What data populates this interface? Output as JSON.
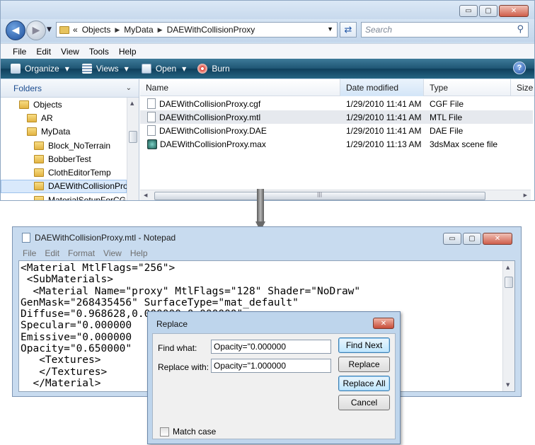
{
  "explorer": {
    "window_buttons": {
      "minimize": "▭",
      "maximize": "▢",
      "close": "✕"
    },
    "address": {
      "prefix": "«",
      "segments": [
        "Objects",
        "MyData",
        "DAEWithCollisionProxy"
      ]
    },
    "search_placeholder": "Search",
    "menu": [
      "File",
      "Edit",
      "View",
      "Tools",
      "Help"
    ],
    "toolbar": {
      "organize": "Organize",
      "views": "Views",
      "open": "Open",
      "burn": "Burn"
    },
    "folders_title": "Folders",
    "tree": [
      {
        "label": "Objects",
        "indent": 0
      },
      {
        "label": "AR",
        "indent": 1
      },
      {
        "label": "MyData",
        "indent": 1
      },
      {
        "label": "Block_NoTerrain",
        "indent": 2
      },
      {
        "label": "BobberTest",
        "indent": 2
      },
      {
        "label": "ClothEditorTemp",
        "indent": 2
      },
      {
        "label": "DAEWithCollisionPro",
        "indent": 2,
        "selected": true
      },
      {
        "label": "MaterialSetupForCGF",
        "indent": 2
      }
    ],
    "columns": {
      "name": "Name",
      "date": "Date modified",
      "type": "Type",
      "size": "Size"
    },
    "files": [
      {
        "name": "DAEWithCollisionProxy.cgf",
        "date": "1/29/2010 11:41 AM",
        "type": "CGF File",
        "icon": "document-icon"
      },
      {
        "name": "DAEWithCollisionProxy.mtl",
        "date": "1/29/2010 11:41 AM",
        "type": "MTL File",
        "icon": "document-icon",
        "selected": true
      },
      {
        "name": "DAEWithCollisionProxy.DAE",
        "date": "1/29/2010 11:41 AM",
        "type": "DAE File",
        "icon": "document-icon"
      },
      {
        "name": "DAEWithCollisionProxy.max",
        "date": "1/29/2010 11:13 AM",
        "type": "3dsMax scene file",
        "icon": "max-file-icon"
      }
    ]
  },
  "notepad": {
    "title": "DAEWithCollisionProxy.mtl - Notepad",
    "menu": [
      "File",
      "Edit",
      "Format",
      "View",
      "Help"
    ],
    "content": "<Material MtlFlags=\"256\">\n <SubMaterials>\n  <Material Name=\"proxy\" MtlFlags=\"128\" Shader=\"NoDraw\"\nGenMask=\"268435456\" SurfaceType=\"mat_default\"\nDiffuse=\"0.968628,0.000000,0.000000\"\nSpecular=\"0.000000                           \nEmissive=\"0.000000                             00\"\nOpacity=\"0.650000\"\n   <Textures>\n   </Textures>\n  </Material>"
  },
  "replace_dialog": {
    "title": "Replace",
    "find_label": "Find what:",
    "find_value": "Opacity=\"0.000000",
    "replace_label": "Replace with:",
    "replace_value": "Opacity=\"1.000000",
    "buttons": {
      "find_next": "Find Next",
      "replace": "Replace",
      "replace_all": "Replace All",
      "cancel": "Cancel"
    },
    "match_case": "Match case",
    "close": "✕"
  }
}
